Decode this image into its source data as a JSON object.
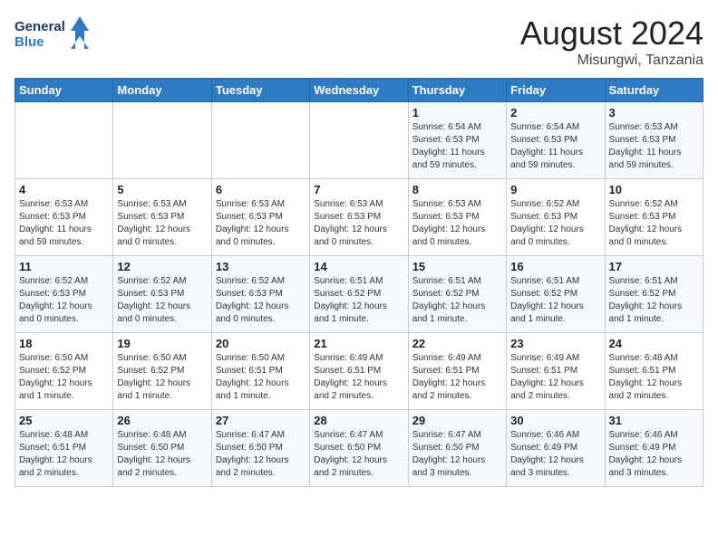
{
  "header": {
    "logo_line1": "General",
    "logo_line2": "Blue",
    "title": "August 2024",
    "subtitle": "Misungwi, Tanzania"
  },
  "days_of_week": [
    "Sunday",
    "Monday",
    "Tuesday",
    "Wednesday",
    "Thursday",
    "Friday",
    "Saturday"
  ],
  "weeks": [
    [
      {
        "day": "",
        "info": ""
      },
      {
        "day": "",
        "info": ""
      },
      {
        "day": "",
        "info": ""
      },
      {
        "day": "",
        "info": ""
      },
      {
        "day": "1",
        "info": "Sunrise: 6:54 AM\nSunset: 6:53 PM\nDaylight: 11 hours\nand 59 minutes."
      },
      {
        "day": "2",
        "info": "Sunrise: 6:54 AM\nSunset: 6:53 PM\nDaylight: 11 hours\nand 59 minutes."
      },
      {
        "day": "3",
        "info": "Sunrise: 6:53 AM\nSunset: 6:53 PM\nDaylight: 11 hours\nand 59 minutes."
      }
    ],
    [
      {
        "day": "4",
        "info": "Sunrise: 6:53 AM\nSunset: 6:53 PM\nDaylight: 11 hours\nand 59 minutes."
      },
      {
        "day": "5",
        "info": "Sunrise: 6:53 AM\nSunset: 6:53 PM\nDaylight: 12 hours\nand 0 minutes."
      },
      {
        "day": "6",
        "info": "Sunrise: 6:53 AM\nSunset: 6:53 PM\nDaylight: 12 hours\nand 0 minutes."
      },
      {
        "day": "7",
        "info": "Sunrise: 6:53 AM\nSunset: 6:53 PM\nDaylight: 12 hours\nand 0 minutes."
      },
      {
        "day": "8",
        "info": "Sunrise: 6:53 AM\nSunset: 6:53 PM\nDaylight: 12 hours\nand 0 minutes."
      },
      {
        "day": "9",
        "info": "Sunrise: 6:52 AM\nSunset: 6:53 PM\nDaylight: 12 hours\nand 0 minutes."
      },
      {
        "day": "10",
        "info": "Sunrise: 6:52 AM\nSunset: 6:53 PM\nDaylight: 12 hours\nand 0 minutes."
      }
    ],
    [
      {
        "day": "11",
        "info": "Sunrise: 6:52 AM\nSunset: 6:53 PM\nDaylight: 12 hours\nand 0 minutes."
      },
      {
        "day": "12",
        "info": "Sunrise: 6:52 AM\nSunset: 6:53 PM\nDaylight: 12 hours\nand 0 minutes."
      },
      {
        "day": "13",
        "info": "Sunrise: 6:52 AM\nSunset: 6:53 PM\nDaylight: 12 hours\nand 0 minutes."
      },
      {
        "day": "14",
        "info": "Sunrise: 6:51 AM\nSunset: 6:52 PM\nDaylight: 12 hours\nand 1 minute."
      },
      {
        "day": "15",
        "info": "Sunrise: 6:51 AM\nSunset: 6:52 PM\nDaylight: 12 hours\nand 1 minute."
      },
      {
        "day": "16",
        "info": "Sunrise: 6:51 AM\nSunset: 6:52 PM\nDaylight: 12 hours\nand 1 minute."
      },
      {
        "day": "17",
        "info": "Sunrise: 6:51 AM\nSunset: 6:52 PM\nDaylight: 12 hours\nand 1 minute."
      }
    ],
    [
      {
        "day": "18",
        "info": "Sunrise: 6:50 AM\nSunset: 6:52 PM\nDaylight: 12 hours\nand 1 minute."
      },
      {
        "day": "19",
        "info": "Sunrise: 6:50 AM\nSunset: 6:52 PM\nDaylight: 12 hours\nand 1 minute."
      },
      {
        "day": "20",
        "info": "Sunrise: 6:50 AM\nSunset: 6:51 PM\nDaylight: 12 hours\nand 1 minute."
      },
      {
        "day": "21",
        "info": "Sunrise: 6:49 AM\nSunset: 6:51 PM\nDaylight: 12 hours\nand 2 minutes."
      },
      {
        "day": "22",
        "info": "Sunrise: 6:49 AM\nSunset: 6:51 PM\nDaylight: 12 hours\nand 2 minutes."
      },
      {
        "day": "23",
        "info": "Sunrise: 6:49 AM\nSunset: 6:51 PM\nDaylight: 12 hours\nand 2 minutes."
      },
      {
        "day": "24",
        "info": "Sunrise: 6:48 AM\nSunset: 6:51 PM\nDaylight: 12 hours\nand 2 minutes."
      }
    ],
    [
      {
        "day": "25",
        "info": "Sunrise: 6:48 AM\nSunset: 6:51 PM\nDaylight: 12 hours\nand 2 minutes."
      },
      {
        "day": "26",
        "info": "Sunrise: 6:48 AM\nSunset: 6:50 PM\nDaylight: 12 hours\nand 2 minutes."
      },
      {
        "day": "27",
        "info": "Sunrise: 6:47 AM\nSunset: 6:50 PM\nDaylight: 12 hours\nand 2 minutes."
      },
      {
        "day": "28",
        "info": "Sunrise: 6:47 AM\nSunset: 6:50 PM\nDaylight: 12 hours\nand 2 minutes."
      },
      {
        "day": "29",
        "info": "Sunrise: 6:47 AM\nSunset: 6:50 PM\nDaylight: 12 hours\nand 3 minutes."
      },
      {
        "day": "30",
        "info": "Sunrise: 6:46 AM\nSunset: 6:49 PM\nDaylight: 12 hours\nand 3 minutes."
      },
      {
        "day": "31",
        "info": "Sunrise: 6:46 AM\nSunset: 6:49 PM\nDaylight: 12 hours\nand 3 minutes."
      }
    ]
  ]
}
